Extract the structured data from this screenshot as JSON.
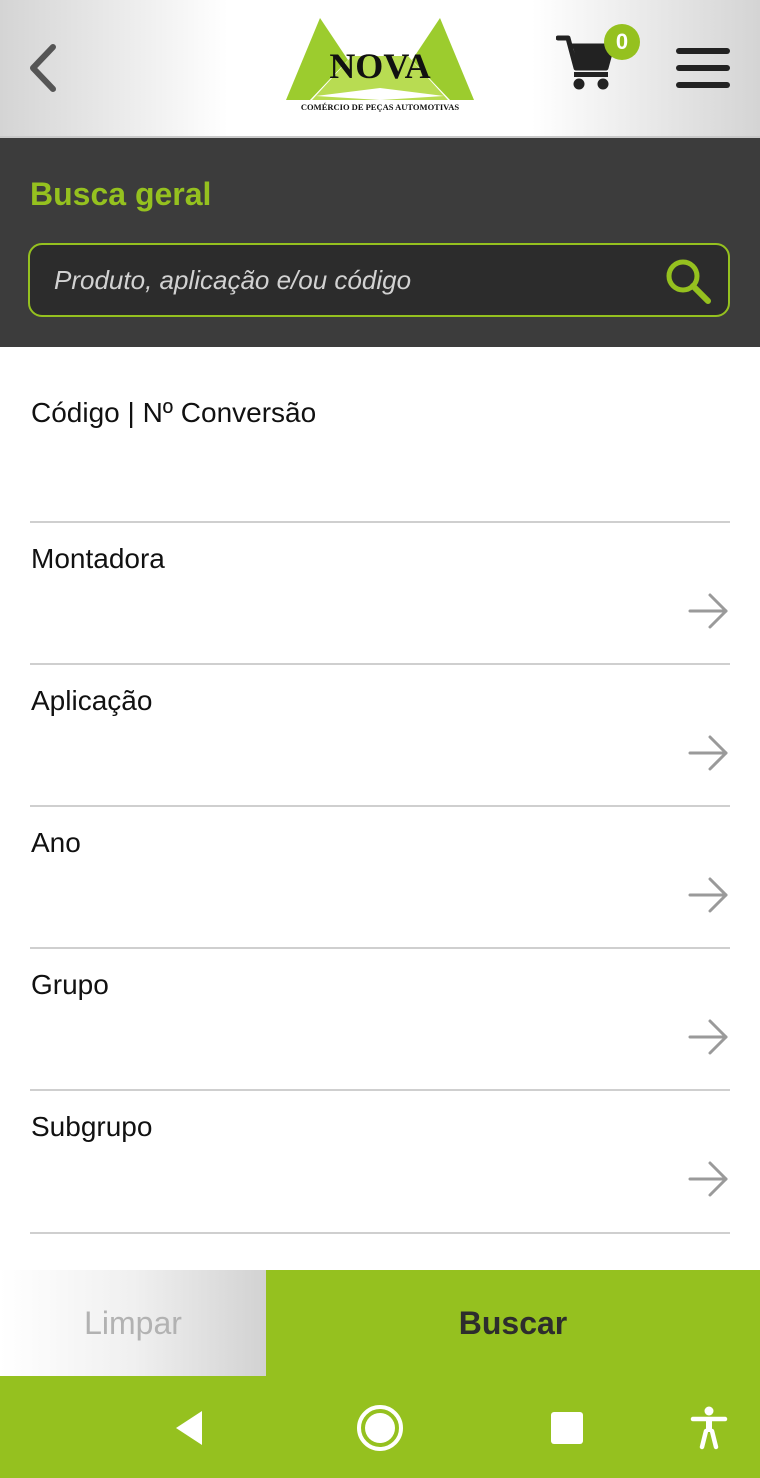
{
  "header": {
    "back_icon": "chevron-left-icon",
    "logo": {
      "name": "NOVA",
      "tagline": "COMÉRCIO DE PEÇAS AUTOMOTIVAS"
    },
    "cart_icon": "cart-icon",
    "cart_count": "0",
    "menu_icon": "hamburger-menu-icon"
  },
  "search": {
    "title": "Busca geral",
    "placeholder": "Produto, aplicação e/ou código",
    "value": "",
    "icon": "search-icon"
  },
  "fields": [
    {
      "label": "Código | Nº Conversão",
      "value": ""
    },
    {
      "label": "Montadora",
      "value": "",
      "icon": "arrow-right-icon"
    },
    {
      "label": "Aplicação",
      "value": "",
      "icon": "arrow-right-icon"
    },
    {
      "label": "Ano",
      "value": "",
      "icon": "arrow-right-icon"
    },
    {
      "label": "Grupo",
      "value": "",
      "icon": "arrow-right-icon"
    },
    {
      "label": "Subgrupo",
      "value": "",
      "icon": "arrow-right-icon"
    }
  ],
  "actions": {
    "clear_label": "Limpar",
    "search_label": "Buscar"
  },
  "system_nav": {
    "items": [
      "back-triangle-icon",
      "home-circle-icon",
      "recents-square-icon",
      "accessibility-icon"
    ]
  },
  "colors": {
    "accent": "#95c11f",
    "panel_dark": "#3c3c3c",
    "divider": "#cfcfcf",
    "text": "#111111",
    "muted_text": "#b2b2b2"
  }
}
